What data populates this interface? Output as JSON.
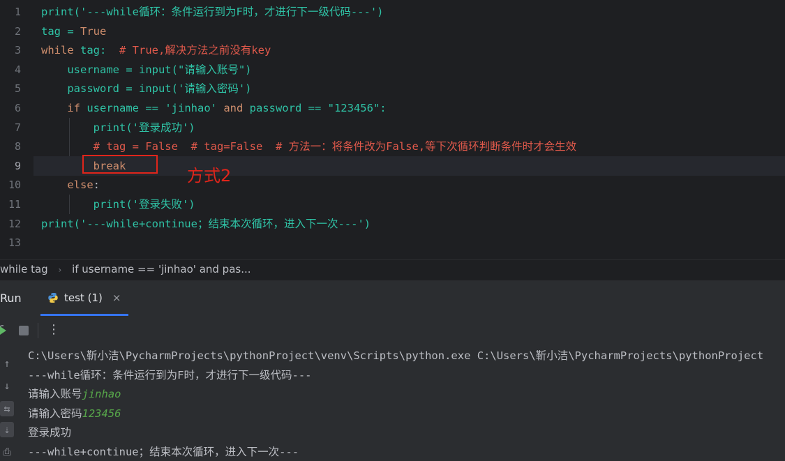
{
  "editor": {
    "line_numbers": [
      "1",
      "2",
      "3",
      "4",
      "5",
      "6",
      "7",
      "8",
      "9",
      "10",
      "11",
      "12",
      "13"
    ],
    "lines": [
      [
        {
          "t": "print",
          "c": "green"
        },
        {
          "t": "('---while循环：条件运行到为F时，才进行下一级代码---')",
          "c": "green"
        }
      ],
      [
        {
          "t": "tag",
          "c": "green"
        },
        {
          "t": " = ",
          "c": "green"
        },
        {
          "t": "True",
          "c": "kw"
        }
      ],
      [
        {
          "t": "while",
          "c": "kw"
        },
        {
          "t": " tag:  ",
          "c": "green"
        },
        {
          "t": "# True,解决方法之前没有key",
          "c": "red-cm"
        }
      ],
      [
        {
          "t": "    username = ",
          "c": "green"
        },
        {
          "t": "input",
          "c": "green"
        },
        {
          "t": "(\"请输入账号\")",
          "c": "green"
        }
      ],
      [
        {
          "t": "    password = ",
          "c": "green"
        },
        {
          "t": "input",
          "c": "green"
        },
        {
          "t": "('请输入密码')",
          "c": "green"
        }
      ],
      [
        {
          "t": "    ",
          "c": "plain"
        },
        {
          "t": "if",
          "c": "kw"
        },
        {
          "t": " username == ",
          "c": "green"
        },
        {
          "t": "'jinhao'",
          "c": "green"
        },
        {
          "t": " and",
          "c": "kw"
        },
        {
          "t": " password == ",
          "c": "green"
        },
        {
          "t": "\"123456\":",
          "c": "green"
        }
      ],
      [
        {
          "t": "        print('登录成功')",
          "c": "green"
        }
      ],
      [
        {
          "t": "        ",
          "c": "plain"
        },
        {
          "t": "# tag = False  # tag=False  # 方法一：将条件改为False,等下次循环判断条件时才会生效",
          "c": "red-cm"
        }
      ],
      [
        {
          "t": "        ",
          "c": "plain"
        },
        {
          "t": "break",
          "c": "kw"
        }
      ],
      [
        {
          "t": "    ",
          "c": "plain"
        },
        {
          "t": "else",
          "c": "kw"
        },
        {
          "t": ":",
          "c": "plain"
        }
      ],
      [
        {
          "t": "        print('登录失败')",
          "c": "green"
        }
      ],
      [
        {
          "t": "print('---while+continue；结束本次循环，进入下一次---')",
          "c": "green"
        }
      ],
      [
        {
          "t": "",
          "c": "plain"
        }
      ]
    ],
    "current_line_index": 8,
    "annotation": "方式2"
  },
  "breadcrumb": {
    "items": [
      "while tag",
      "if username == 'jinhao' and pas..."
    ],
    "separator": "›"
  },
  "run_panel": {
    "title": "Run",
    "tab_label": "test (1)",
    "tab_close": "×",
    "toolbar_icons": [
      "rerun-icon",
      "stop-icon",
      "more-icon"
    ],
    "more_glyph": "⋮",
    "side_icons": [
      "arrow-up-icon",
      "arrow-down-icon",
      "soft-wrap-icon",
      "scroll-to-end-icon",
      "print-icon"
    ],
    "console": [
      {
        "text": "C:\\Users\\靳小洁\\PycharmProjects\\pythonProject\\venv\\Scripts\\python.exe C:\\Users\\靳小洁\\PycharmProjects\\pythonProject",
        "input": ""
      },
      {
        "text": "---while循环：条件运行到为F时，才进行下一级代码---",
        "input": ""
      },
      {
        "text": "请输入账号",
        "input": "jinhao"
      },
      {
        "text": "请输入密码",
        "input": "123456"
      },
      {
        "text": "登录成功",
        "input": ""
      },
      {
        "text": "---while+continue；结束本次循环，进入下一次---",
        "input": ""
      }
    ]
  },
  "colors": {
    "background": "#1e1f22",
    "keyword": "#cf8e6d",
    "string": "#2fc3a6",
    "comment": "#e0594b",
    "annotation": "#e0251b",
    "accent": "#3574f0"
  }
}
